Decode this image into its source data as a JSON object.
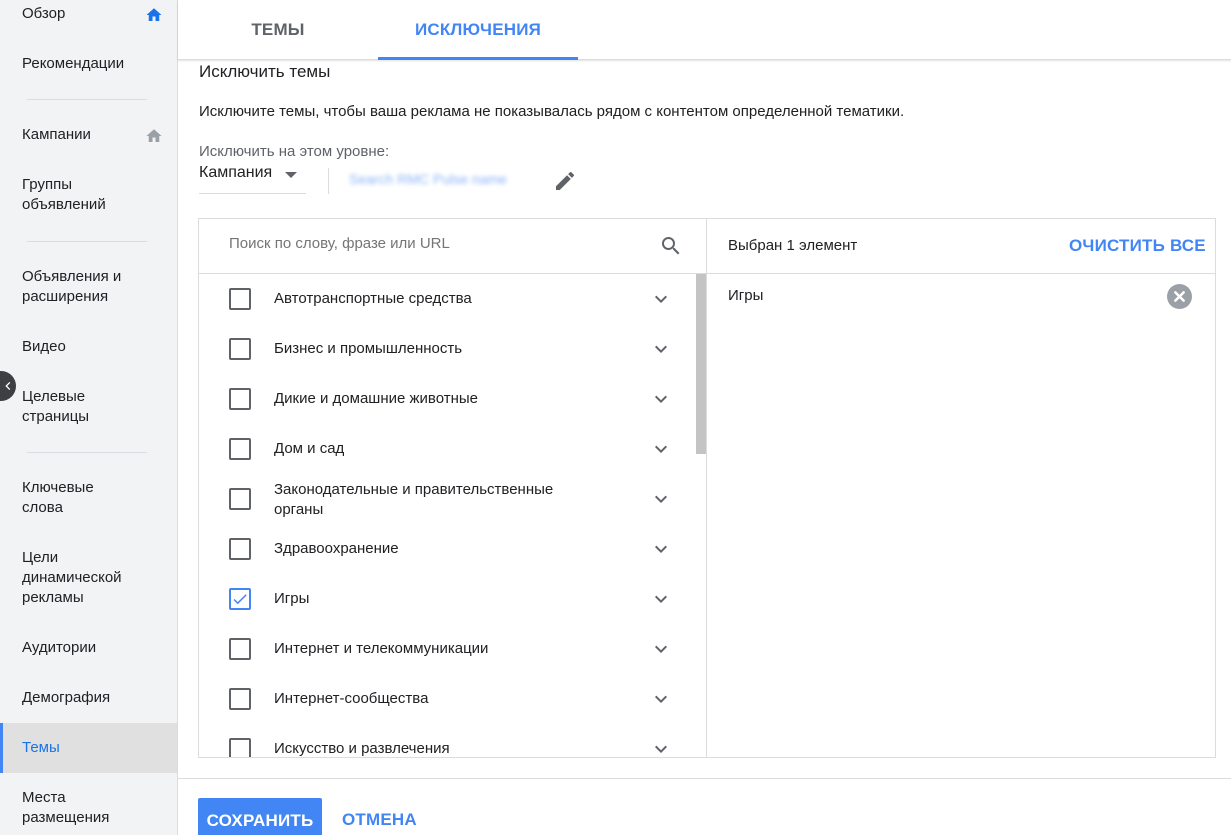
{
  "sidebar": {
    "items": [
      {
        "label": "Обзор",
        "icon": "home-icon"
      },
      {
        "label": "Рекомендации"
      },
      {
        "label": "Кампании",
        "icon": "home-icon"
      },
      {
        "label": "Группы объявлений"
      },
      {
        "label": "Объявления и расширения"
      },
      {
        "label": "Видео"
      },
      {
        "label": "Целевые страницы"
      },
      {
        "label": "Ключевые слова"
      },
      {
        "label": "Цели динамической рекламы"
      },
      {
        "label": "Аудитории"
      },
      {
        "label": "Демография"
      },
      {
        "label": "Темы",
        "active": true
      },
      {
        "label": "Места размещения"
      }
    ]
  },
  "tabs": {
    "topics": "ТЕМЫ",
    "exclusions": "ИСКЛЮЧЕНИЯ"
  },
  "main": {
    "title": "Исключить темы",
    "description": "Исключите темы, чтобы ваша реклама не показывалась рядом с контентом определенной тематики.",
    "level_label": "Исключить на этом уровне:",
    "level_value": "Кампания",
    "campaign_name": "Search RMC Pulse name"
  },
  "search": {
    "placeholder": "Поиск по слову, фразе или URL"
  },
  "topics": [
    {
      "label": "Автотранспортные средства",
      "checked": false
    },
    {
      "label": "Бизнес и промышленность",
      "checked": false
    },
    {
      "label": "Дикие и домашние животные",
      "checked": false
    },
    {
      "label": "Дом и сад",
      "checked": false
    },
    {
      "label": "Законодательные и правительственные органы",
      "checked": false
    },
    {
      "label": "Здравоохранение",
      "checked": false
    },
    {
      "label": "Игры",
      "checked": true
    },
    {
      "label": "Интернет и телекоммуникации",
      "checked": false
    },
    {
      "label": "Интернет-сообщества",
      "checked": false
    },
    {
      "label": "Искусство и развлечения",
      "checked": false
    }
  ],
  "selected": {
    "count_text": "Выбран 1 элемент",
    "clear_all": "ОЧИСТИТЬ ВСЕ",
    "items": [
      "Игры"
    ]
  },
  "footer": {
    "save": "СОХРАНИТЬ",
    "cancel": "ОТМЕНА"
  },
  "colors": {
    "accent": "#4285f4",
    "sidebar_bg": "#f1f3f4",
    "active_bg": "#e0e0e0"
  }
}
